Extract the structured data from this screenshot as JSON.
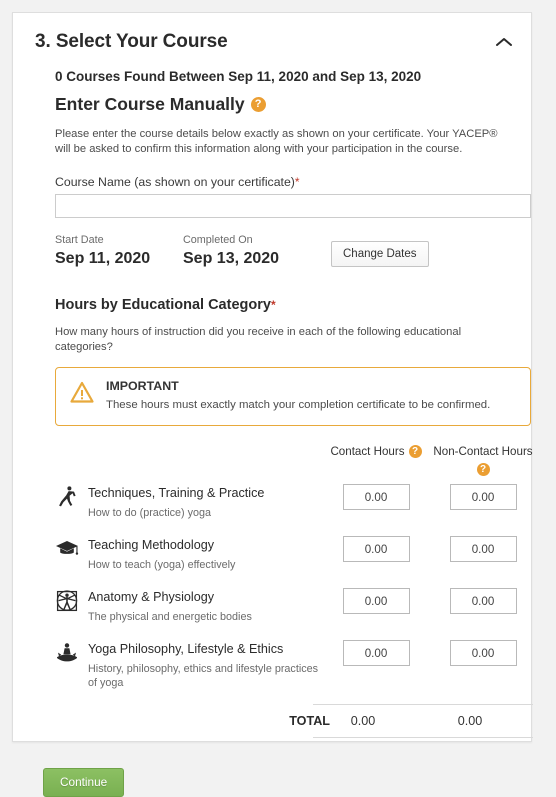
{
  "section": {
    "number_title": "3. Select Your Course",
    "collapse_icon": "chevron-up-icon",
    "courses_found": "0 Courses Found Between Sep 11, 2020 and Sep 13, 2020",
    "manual_title": "Enter Course Manually",
    "manual_help_icon": "?",
    "intro_text": "Please enter the course details below exactly as shown on your certificate. Your YACEP® will be asked to confirm this information along with your participation in the course."
  },
  "course_name": {
    "label": "Course Name (as shown on your certificate)",
    "required_marker": "*",
    "value": "",
    "placeholder": ""
  },
  "dates": {
    "start_label": "Start Date",
    "start_value": "Sep 11, 2020",
    "completed_label": "Completed On",
    "completed_value": "Sep 13, 2020",
    "change_button": "Change Dates"
  },
  "hours": {
    "title": "Hours by Educational Category",
    "required_marker": "*",
    "subtitle": "How many hours of instruction did you receive in each of the following educational categories?",
    "important": {
      "icon": "warning-triangle-icon",
      "label": "IMPORTANT",
      "text": "These hours must exactly match your completion certificate to be confirmed."
    },
    "columns": [
      {
        "label": "Contact Hours",
        "help_icon": "?"
      },
      {
        "label": "Non-Contact Hours",
        "help_icon": "?"
      }
    ],
    "categories": [
      {
        "icon": "yoga-warrior-pose-icon",
        "name": "Techniques, Training & Practice",
        "desc": "How to do (practice) yoga",
        "contact": "0.00",
        "non_contact": "0.00"
      },
      {
        "icon": "graduation-cap-icon",
        "name": "Teaching Methodology",
        "desc": "How to teach (yoga) effectively",
        "contact": "0.00",
        "non_contact": "0.00"
      },
      {
        "icon": "vitruvian-man-icon",
        "name": "Anatomy & Physiology",
        "desc": "The physical and energetic bodies",
        "contact": "0.00",
        "non_contact": "0.00"
      },
      {
        "icon": "lotus-meditation-icon",
        "name": "Yoga Philosophy, Lifestyle & Ethics",
        "desc": "History, philosophy, ethics and lifestyle practices of yoga",
        "contact": "0.00",
        "non_contact": "0.00"
      }
    ],
    "total_label": "TOTAL",
    "total_contact": "0.00",
    "total_non_contact": "0.00"
  },
  "footer": {
    "continue_label": "Continue"
  },
  "colors": {
    "accent_orange": "#eb9e32",
    "warning_border": "#e8a93b",
    "continue_green": "#8cc063",
    "required_red": "#c0392b",
    "card_border": "#dedede",
    "page_bg": "#f2f2f2"
  }
}
